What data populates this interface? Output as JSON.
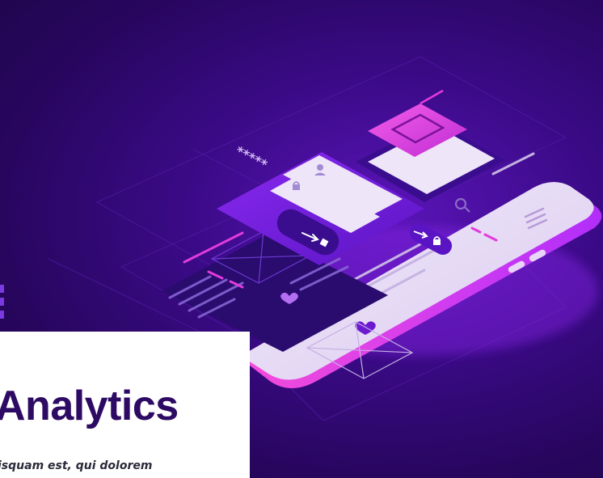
{
  "hero": {
    "title": "Analytics",
    "subtitle": "isquam est, qui dolorem"
  },
  "illustration": {
    "password_mask": "*****",
    "icons": [
      "user-icon",
      "lock-icon",
      "search-icon",
      "arrow-right-icon",
      "heart-icon",
      "hamburger-icon"
    ]
  },
  "colors": {
    "background_dark": "#27065d",
    "background_mid": "#3a0a86",
    "accent_purple": "#7a1ee6",
    "accent_magenta": "#e23bdc",
    "phone_screen": "#e9def5",
    "title_text": "#2d0a63"
  }
}
